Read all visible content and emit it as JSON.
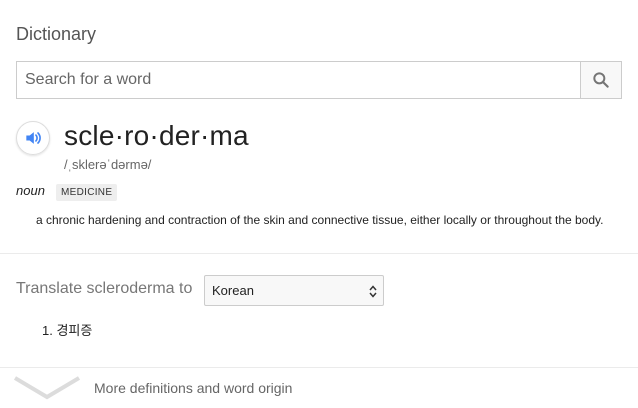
{
  "dictionary": {
    "title": "Dictionary",
    "search": {
      "placeholder": "Search for a word",
      "value": ""
    },
    "entry": {
      "word": "scle·ro·der·ma",
      "phonetic": "/ˌsklerəˈdərmə/",
      "part_of_speech": "noun",
      "domain_badge": "MEDICINE",
      "definition": "a chronic hardening and contraction of the skin and connective tissue, either locally or throughout the body."
    },
    "translate": {
      "label": "Translate scleroderma to",
      "selected_language": "Korean",
      "results": [
        "1. 경피증"
      ]
    },
    "more_link": "More definitions and word origin"
  },
  "colors": {
    "accent_blue": "#4285f4",
    "icon_gray": "#757575"
  }
}
